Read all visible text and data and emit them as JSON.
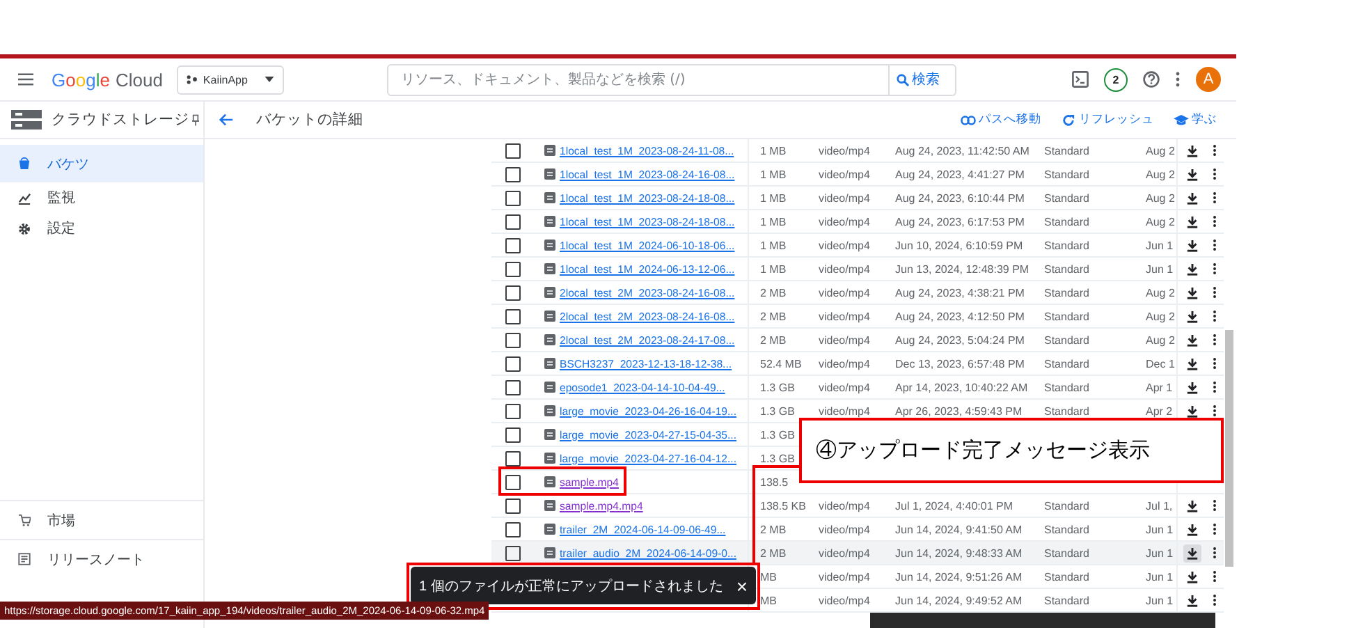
{
  "header": {
    "logo": [
      "Google",
      "Cloud"
    ],
    "project": "KaiinApp",
    "search": {
      "placeholder": "リソース、ドキュメント、製品などを検索 (/)",
      "button": "検索"
    },
    "notifications": "2",
    "avatar": "A"
  },
  "subheader": {
    "product": "クラウドストレージ",
    "title": "バケットの詳細",
    "actions": [
      {
        "kind": "link",
        "label": "パスへ移動"
      },
      {
        "kind": "refresh",
        "label": "リフレッシュ"
      },
      {
        "kind": "learn",
        "label": "学ぶ"
      }
    ]
  },
  "sidebar": {
    "items": [
      {
        "kind": "bucket",
        "label": "バケツ",
        "selected": true
      },
      {
        "kind": "monitor",
        "label": "監視",
        "selected": false
      },
      {
        "kind": "settings",
        "label": "設定",
        "selected": false
      }
    ],
    "bottom_items": [
      {
        "kind": "market",
        "label": "市場"
      },
      {
        "kind": "notes",
        "label": "リリースノート"
      }
    ]
  },
  "rows": [
    {
      "checked": false,
      "name": "1local_test_1M_2023-08-24-11-08...",
      "size": "1 MB",
      "type": "video/mp4",
      "created": "Aug 24, 2023, 11:42:50 AM",
      "class": "Standard",
      "updated": "Aug 2"
    },
    {
      "checked": false,
      "name": "1local_test_1M_2023-08-24-16-08...",
      "size": "1 MB",
      "type": "video/mp4",
      "created": "Aug 24, 2023, 4:41:27 PM",
      "class": "Standard",
      "updated": "Aug 2"
    },
    {
      "checked": false,
      "name": "1local_test_1M_2023-08-24-18-08...",
      "size": "1 MB",
      "type": "video/mp4",
      "created": "Aug 24, 2023, 6:10:44 PM",
      "class": "Standard",
      "updated": "Aug 2"
    },
    {
      "checked": false,
      "name": "1local_test_1M_2023-08-24-18-08...",
      "size": "1 MB",
      "type": "video/mp4",
      "created": "Aug 24, 2023, 6:17:53 PM",
      "class": "Standard",
      "updated": "Aug 2"
    },
    {
      "checked": false,
      "name": "1local_test_1M_2024-06-10-18-06...",
      "size": "1 MB",
      "type": "video/mp4",
      "created": "Jun 10, 2024, 6:10:59 PM",
      "class": "Standard",
      "updated": "Jun 1"
    },
    {
      "checked": false,
      "name": "1local_test_1M_2024-06-13-12-06...",
      "size": "1 MB",
      "type": "video/mp4",
      "created": "Jun 13, 2024, 12:48:39 PM",
      "class": "Standard",
      "updated": "Jun 1"
    },
    {
      "checked": false,
      "name": "2local_test_2M_2023-08-24-16-08...",
      "size": "2 MB",
      "type": "video/mp4",
      "created": "Aug 24, 2023, 4:38:21 PM",
      "class": "Standard",
      "updated": "Aug 2"
    },
    {
      "checked": false,
      "name": "2local_test_2M_2023-08-24-16-08...",
      "size": "2 MB",
      "type": "video/mp4",
      "created": "Aug 24, 2023, 4:12:50 PM",
      "class": "Standard",
      "updated": "Aug 2"
    },
    {
      "checked": false,
      "name": "2local_test_2M_2023-08-24-17-08...",
      "size": "2 MB",
      "type": "video/mp4",
      "created": "Aug 24, 2023, 5:04:24 PM",
      "class": "Standard",
      "updated": "Aug 2"
    },
    {
      "checked": false,
      "name": "BSCH3237_2023-12-13-18-12-38...",
      "size": "52.4 MB",
      "type": "video/mp4",
      "created": "Dec 13, 2023, 6:57:48 PM",
      "class": "Standard",
      "updated": "Dec 1"
    },
    {
      "checked": false,
      "name": "eposode1_2023-04-14-10-04-49...",
      "size": "1.3 GB",
      "type": "video/mp4",
      "created": "Apr 14, 2023, 10:40:22 AM",
      "class": "Standard",
      "updated": "Apr 1"
    },
    {
      "checked": false,
      "name": "large_movie_2023-04-26-16-04-19...",
      "size": "1.3 GB",
      "type": "video/mp4",
      "created": "Apr 26, 2023, 4:59:43 PM",
      "class": "Standard",
      "updated": "Apr 2"
    },
    {
      "checked": false,
      "name": "large_movie_2023-04-27-15-04-35...",
      "size": "1.3 GB"
    },
    {
      "checked": false,
      "name": "large_movie_2023-04-27-16-04-12...",
      "size": "1.3 GB"
    },
    {
      "checked": false,
      "name": "sample.mp4",
      "visited": true,
      "size": "138.5"
    },
    {
      "checked": false,
      "name": "sample.mp4.mp4",
      "visited": true,
      "size": "138.5 KB",
      "type": "video/mp4",
      "created": "Jul 1, 2024, 4:40:01 PM",
      "class": "Standard",
      "updated": "Jul 1,"
    },
    {
      "checked": false,
      "name": "trailer_2M_2024-06-14-09-06-49...",
      "size": "2 MB",
      "type": "video/mp4",
      "created": "Jun 14, 2024, 9:41:50 AM",
      "class": "Standard",
      "updated": "Jun 1"
    },
    {
      "checked": false,
      "name": "trailer_audio_2M_2024-06-14-09-0...",
      "hovered": true,
      "size": "2 MB",
      "type": "video/mp4",
      "created": "Jun 14, 2024, 9:48:33 AM",
      "class": "Standard",
      "updated": "Jun 1"
    },
    {
      "size": "MB",
      "type": "video/mp4",
      "created": "Jun 14, 2024, 9:51:26 AM",
      "class": "Standard",
      "updated": "Jun 1"
    },
    {
      "size": "MB",
      "type": "video/mp4",
      "created": "Jun 14, 2024, 9:49:52 AM",
      "class": "Standard",
      "updated": "Jun 1"
    }
  ],
  "toast": {
    "message": "1 個のファイルが正常にアップロードされました",
    "close": "×"
  },
  "annotation": {
    "callout": "④アップロード完了メッセージ表示"
  },
  "status_url": "https://storage.cloud.google.com/17_kaiin_app_194/videos/trailer_audio_2M_2024-06-14-09-06-32.mp4"
}
